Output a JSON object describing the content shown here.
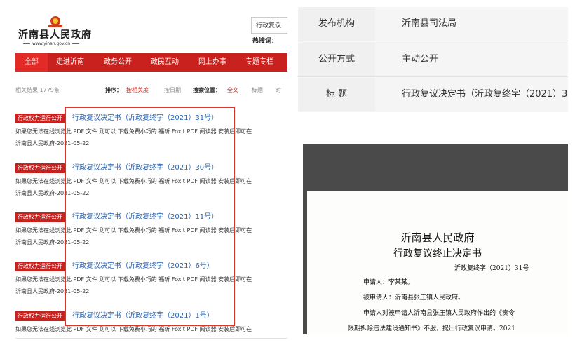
{
  "site": {
    "title": "沂南县人民政府",
    "url": "www.yinan.gov.cn",
    "search_text": "行政复议",
    "hot_label": "热搜词："
  },
  "nav": [
    "全部",
    "走进沂南",
    "政务公开",
    "政民互动",
    "网上办事",
    "专题专栏"
  ],
  "filters": {
    "count": "相关结果 1779条",
    "sort_label": "排序：",
    "sort_relevance": "按相关度",
    "sort_date": "按日期",
    "scope_label": "搜索位置：",
    "scope_all": "全文",
    "scope_title": "标题",
    "scope_time": "时"
  },
  "results": [
    {
      "tag": "行政权力运行公开",
      "title": "行政复议决定书（沂政复终字（2021）31号）",
      "desc": "如果您无法在线浏览此 PDF 文件 则可以 下载免费小巧的 福昕 Foxit PDF 阅读器 安装后即可在",
      "date": "沂南县人民政府-2021-05-22"
    },
    {
      "tag": "行政权力运行公开",
      "title": "行政复议决定书（沂政复终字（2021）30号）",
      "desc": "如果您无法在线浏览此 PDF 文件 则可以 下载免费小巧的 福昕 Foxit PDF 阅读器 安装后即可在",
      "date": "沂南县人民政府-2021-05-22"
    },
    {
      "tag": "行政权力运行公开",
      "title": "行政复议决定书（沂政复终字（2021）11号）",
      "desc": "如果您无法在线浏览此 PDF 文件 则可以 下载免费小巧的 福昕 Foxit PDF 阅读器 安装后即可在",
      "date": "沂南县人民政府-2021-05-22"
    },
    {
      "tag": "行政权力运行公开",
      "title": "行政复议决定书（沂政复终字（2021）6号）",
      "desc": "如果您无法在线浏览此 PDF 文件 则可以 下载免费小巧的 福昕 Foxit PDF 阅读器 安装后即可在",
      "date": "沂南县人民政府-2021-05-22"
    },
    {
      "tag": "行政权力运行公开",
      "title": "行政复议决定书（沂政复终字（2021）1号）",
      "desc": "如果您无法在线浏览此 PDF 文件 则可以 下载免费小巧的 福昕 Foxit PDF 阅读器 安装后即可在",
      "date": ""
    }
  ],
  "info": [
    {
      "key": "发布机构",
      "value": "沂南县司法局"
    },
    {
      "key": "公开方式",
      "value": "主动公开"
    },
    {
      "key": "标 题",
      "value": "行政复议决定书（沂政复终字（2021）3"
    }
  ],
  "document": {
    "org": "沂南县人民政府",
    "doc_title": "行政复议终止决定书",
    "doc_no": "沂政复终字（2021）31号",
    "applicant": "申请人：李某某。",
    "respondent": "被申请人：沂南县张庄镇人民政府。",
    "body_line1": "申请人对被申请人沂南县张庄镇人民政府作出的《责令",
    "body_line2": "限期拆除违法建设通知书》不服，提出行政复议申请。2021"
  },
  "colors": {
    "brand_red": "#c9211e",
    "link_blue": "#2a66b5",
    "highlight_box": "#d9342b"
  }
}
